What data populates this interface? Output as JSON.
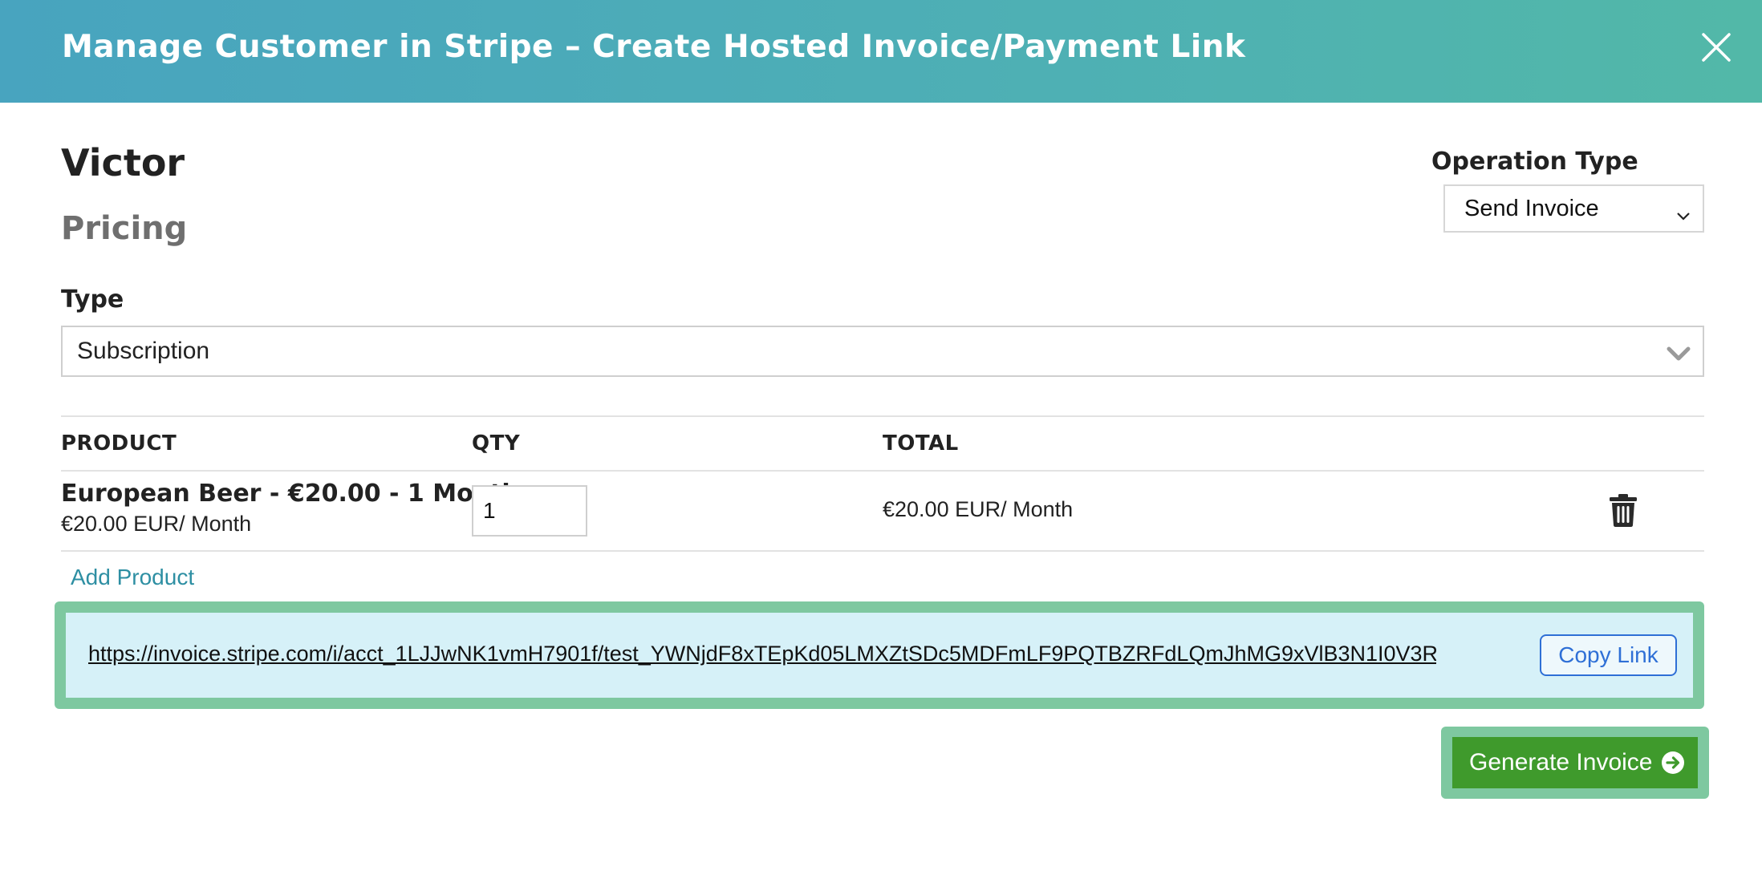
{
  "modal": {
    "title": "Manage Customer in Stripe – Create Hosted Invoice/Payment Link",
    "close_icon": "close-icon"
  },
  "customer": {
    "name": "Victor"
  },
  "pricing": {
    "heading": "Pricing"
  },
  "operation_type": {
    "label": "Operation Type",
    "selected": "Send Invoice"
  },
  "type": {
    "label": "Type",
    "selected": "Subscription"
  },
  "table": {
    "headers": {
      "product": "PRODUCT",
      "qty": "QTY",
      "total": "TOTAL"
    },
    "rows": [
      {
        "product_name": "European Beer - €20.00 - 1 Month",
        "product_price": "€20.00 EUR/ Month",
        "qty": "1",
        "total": "€20.00 EUR/ Month",
        "delete_icon": "trash-icon"
      }
    ]
  },
  "add_product_label": "Add Product",
  "invoice_link": {
    "url": "https://invoice.stripe.com/i/acct_1LJJwNK1vmH7901f/test_YWNjdF8xTEpKd05LMXZtSDc5MDFmLF9PQTBZRFdLQmJhMG9xVlB3N1I0V3R...",
    "copy_label": "Copy Link"
  },
  "generate_button": {
    "label": "Generate Invoice",
    "icon": "arrow-right-circle-icon"
  },
  "colors": {
    "header_gradient_start": "#48a4bf",
    "header_gradient_end": "#52b8a8",
    "accent_teal": "#2e8fa3",
    "highlight_green": "#7ec8a0",
    "link_box_bg": "#d6f1f8",
    "copy_link_blue": "#2e6fd6",
    "generate_green": "#3f9a2c"
  }
}
